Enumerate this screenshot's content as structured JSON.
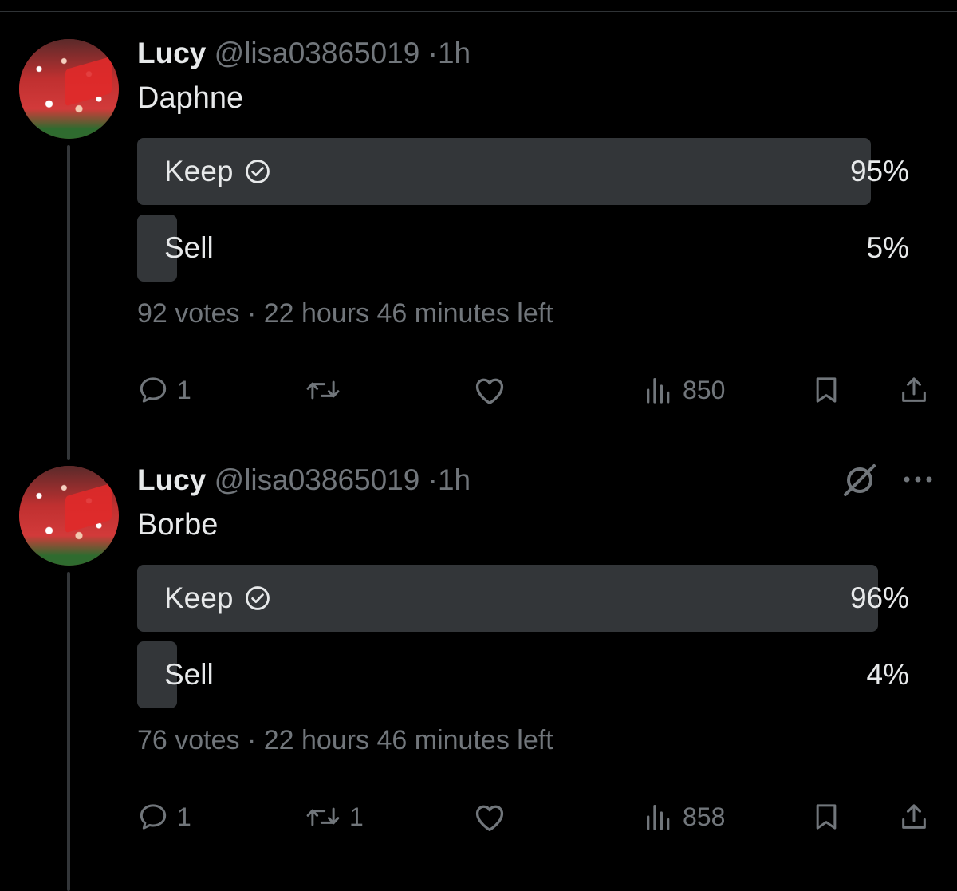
{
  "tweets": [
    {
      "name": "Lucy",
      "handle": "@lisa03865019",
      "separator": "·",
      "time": "1h",
      "text": "Daphne",
      "poll": {
        "options": [
          {
            "label": "Keep",
            "percent": "95%",
            "fraction": 0.95,
            "selected": true
          },
          {
            "label": "Sell",
            "percent": "5%",
            "fraction": 0.05,
            "selected": false
          }
        ],
        "meta": "92 votes · 22 hours 46 minutes left"
      },
      "actions": {
        "replies": "1",
        "retweets": "",
        "likes": "",
        "views": "850"
      }
    },
    {
      "name": "Lucy",
      "handle": "@lisa03865019",
      "separator": "·",
      "time": "1h",
      "text": "Borbe",
      "poll": {
        "options": [
          {
            "label": "Keep",
            "percent": "96%",
            "fraction": 0.96,
            "selected": true
          },
          {
            "label": "Sell",
            "percent": "4%",
            "fraction": 0.04,
            "selected": false
          }
        ],
        "meta": "76 votes · 22 hours 46 minutes left"
      },
      "actions": {
        "replies": "1",
        "retweets": "1",
        "likes": "",
        "views": "858"
      }
    }
  ],
  "icons": {
    "reply": "speech-bubble-icon",
    "retweet": "retweet-arrows-icon",
    "like": "heart-icon",
    "views": "bar-chart-icon",
    "bookmark": "bookmark-icon",
    "share": "share-upload-icon",
    "grok": "grok-slash-circle-icon",
    "more": "ellipsis-icon"
  },
  "colors": {
    "background": "#000000",
    "text": "#e7e9ea",
    "muted": "#71767b",
    "poll_bar": "#333639"
  }
}
